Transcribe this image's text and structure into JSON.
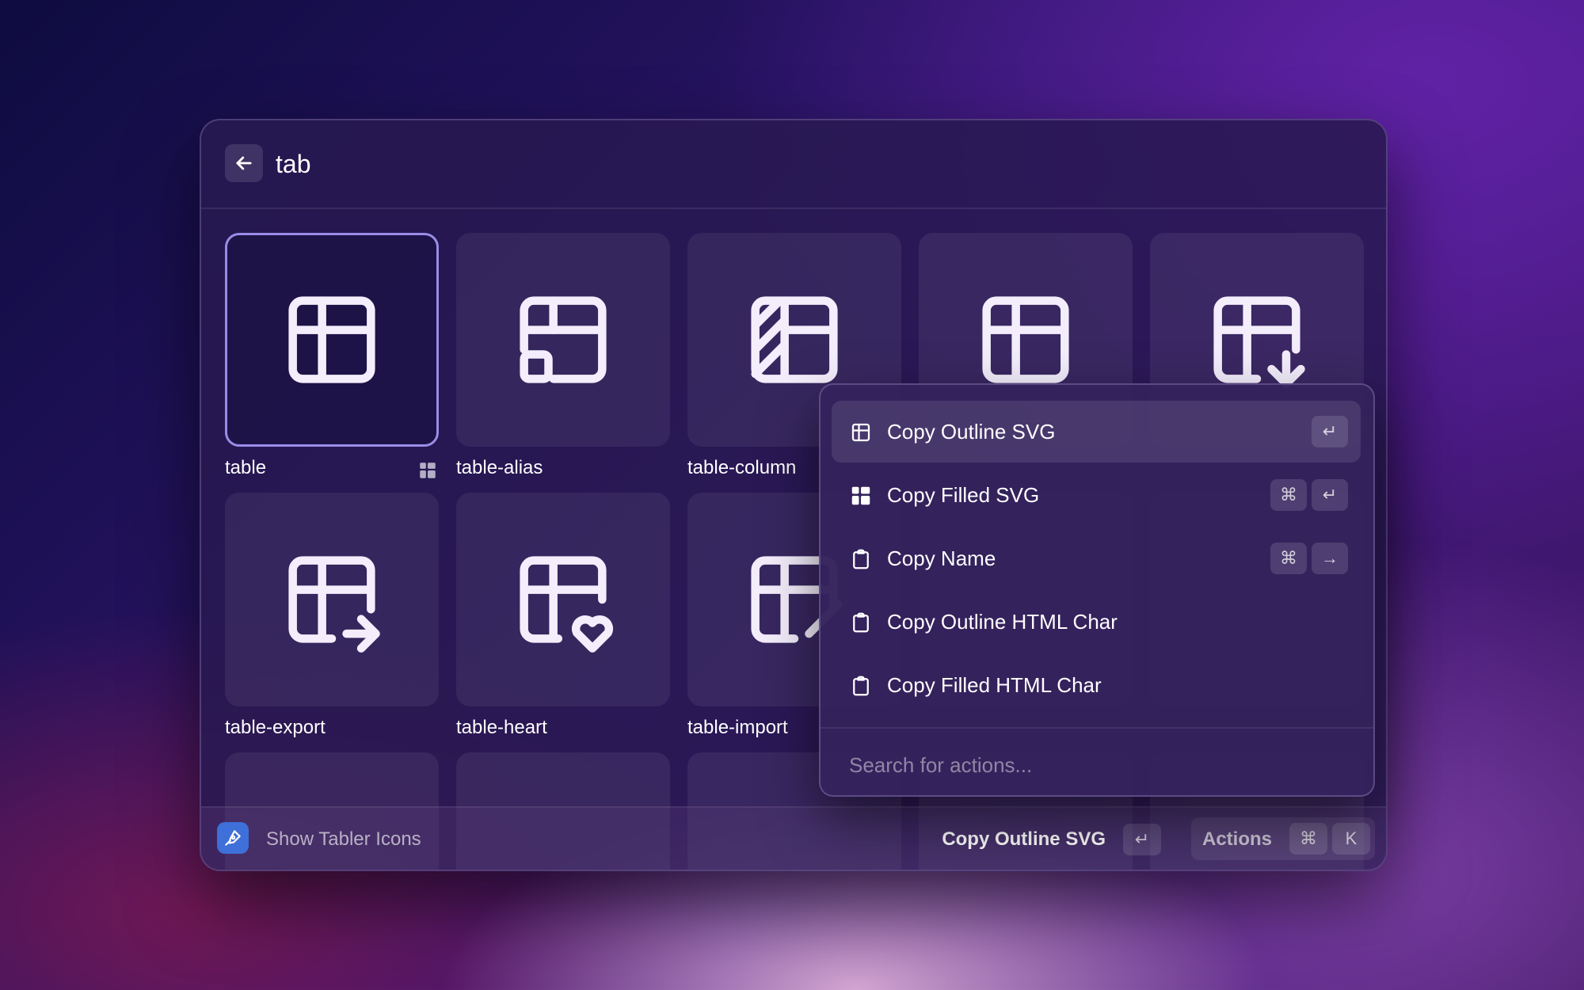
{
  "search": {
    "query": "tab"
  },
  "icons": [
    {
      "name": "table",
      "selected": true
    },
    {
      "name": "table-alias"
    },
    {
      "name": "table-column"
    },
    {
      "name": "table-export"
    },
    {
      "name": "table-heart"
    },
    {
      "name": "table-import"
    }
  ],
  "action_menu": {
    "items": [
      {
        "label": "Copy Outline SVG",
        "icon": "table-icon",
        "shortcut": [
          "↵"
        ]
      },
      {
        "label": "Copy Filled SVG",
        "icon": "table-filled-icon",
        "shortcut": [
          "⌘",
          "↵"
        ]
      },
      {
        "label": "Copy Name",
        "icon": "clipboard-icon",
        "shortcut": [
          "⌘",
          "→"
        ]
      },
      {
        "label": "Copy Outline HTML Char",
        "icon": "clipboard-icon",
        "shortcut": []
      },
      {
        "label": "Copy Filled HTML Char",
        "icon": "clipboard-icon",
        "shortcut": []
      }
    ],
    "search_placeholder": "Search for actions..."
  },
  "footer": {
    "extension_name": "Show Tabler Icons",
    "primary_action": "Copy Outline SVG",
    "primary_key": "↵",
    "actions_label": "Actions",
    "actions_keys": [
      "⌘",
      "K"
    ]
  },
  "colors": {
    "accent": "#9a8de8",
    "extension_icon_bg": "#3f6fd8"
  }
}
